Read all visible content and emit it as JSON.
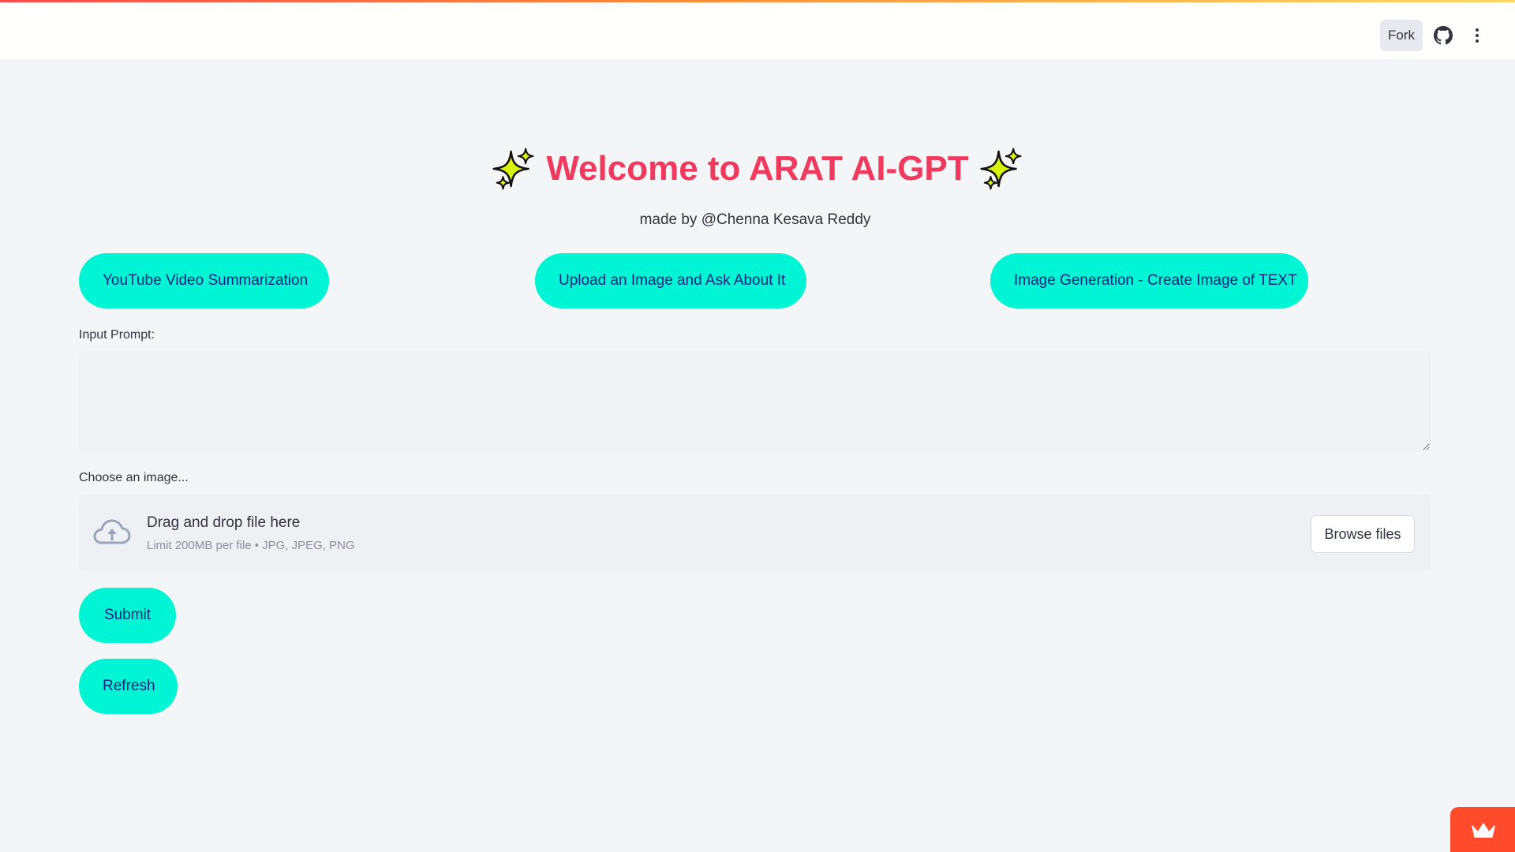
{
  "header": {
    "fork_label": "Fork"
  },
  "hero": {
    "title": "Welcome to ARAT AI-GPT",
    "subtitle": "made by @Chenna Kesava Reddy"
  },
  "modes": {
    "youtube_label": "YouTube Video Summarization",
    "upload_label": "Upload an Image and Ask About It",
    "generate_label": "Image Generation - Create Image of TEXT"
  },
  "prompt": {
    "label": "Input Prompt:",
    "value": ""
  },
  "uploader": {
    "label": "Choose an image...",
    "drop_title": "Drag and drop file here",
    "drop_limit": "Limit 200MB per file • JPG, JPEG, PNG",
    "browse_label": "Browse files"
  },
  "actions": {
    "submit_label": "Submit",
    "refresh_label": "Refresh"
  },
  "colors": {
    "title": "#ef3a5d",
    "button_bg": "#00f5d4",
    "button_text": "#1a237e",
    "badge": "#ff4b2b"
  },
  "icons": {
    "github": "github-icon",
    "menu": "more-vertical-icon",
    "sparkle": "sparkle-icon",
    "upload": "cloud-upload-icon",
    "crown": "crown-icon"
  }
}
